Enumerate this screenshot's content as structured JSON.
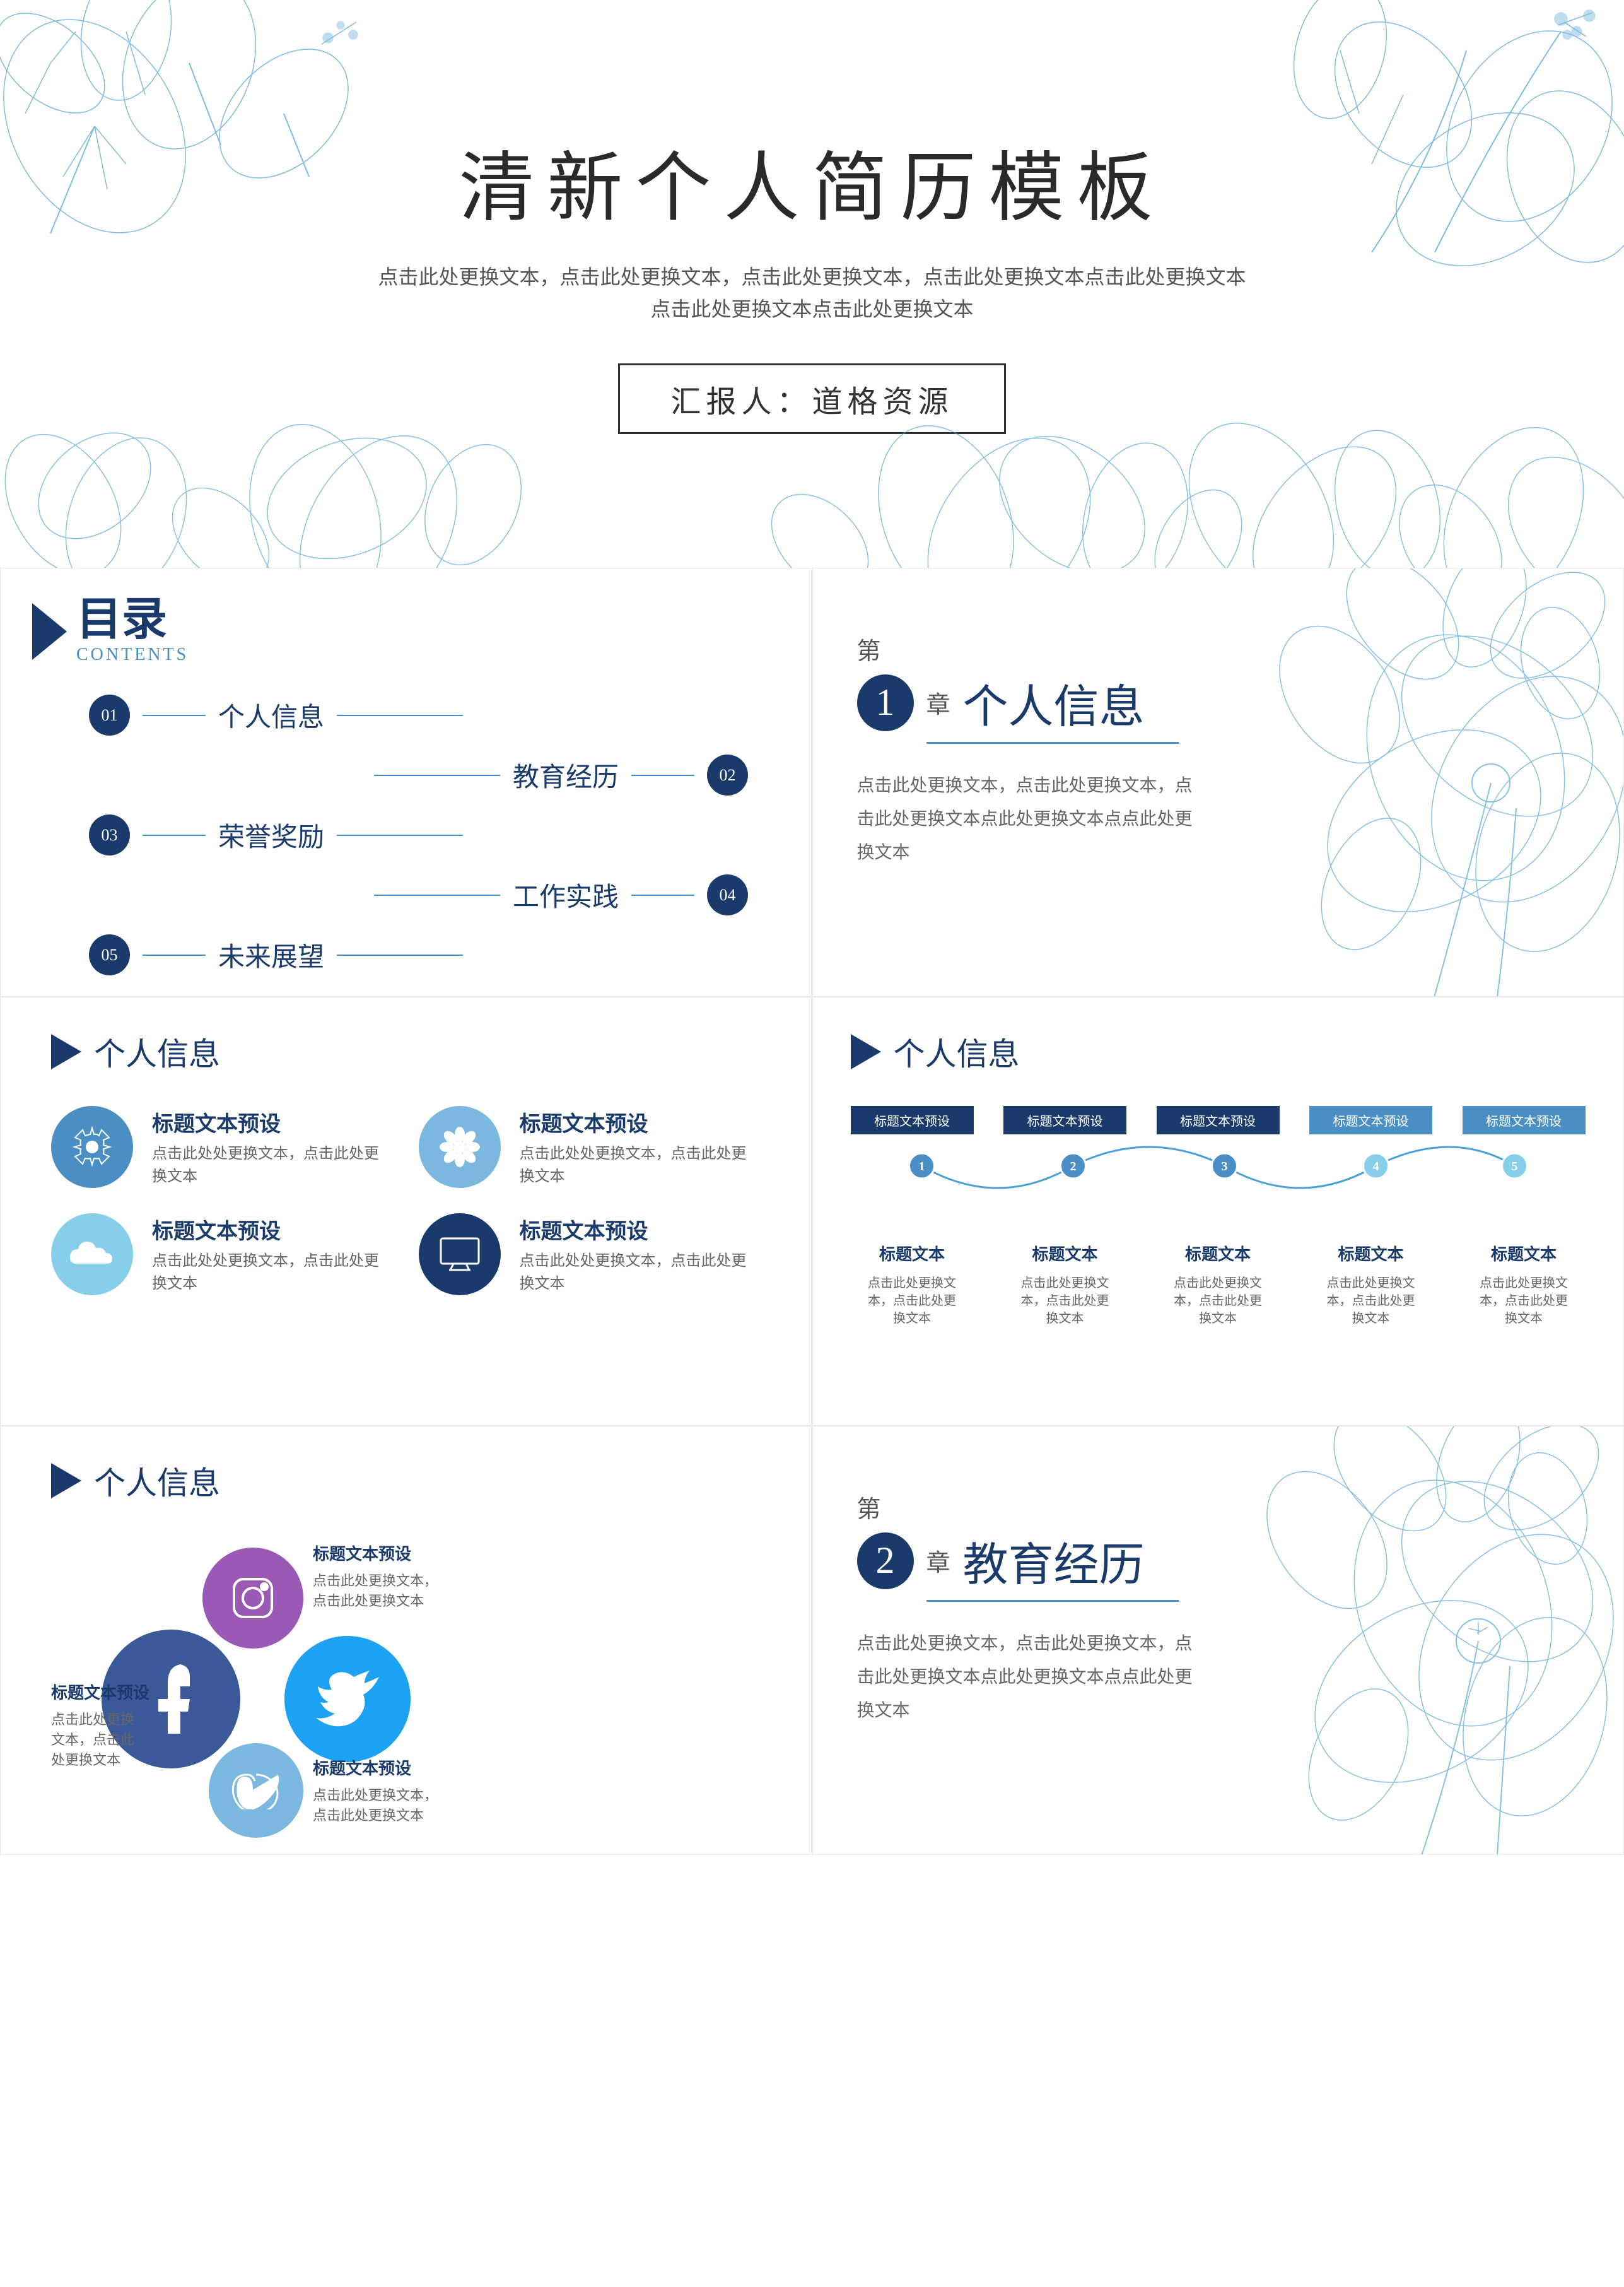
{
  "cover": {
    "title": "清新个人简历模板",
    "subtitle_line1": "点击此处更换文本，点击此处更换文本，点击此处更换文本，点击此处更换文本点击此处更换文本",
    "subtitle_line2": "点击此处更换文本点击此处更换文本",
    "author_label": "汇报人：道格资源"
  },
  "toc": {
    "title_cn": "目录",
    "title_en": "CONTENTS",
    "items": [
      {
        "num": "01",
        "label": "个人信息",
        "align": "left"
      },
      {
        "num": "02",
        "label": "教育经历",
        "align": "right"
      },
      {
        "num": "03",
        "label": "荣誉奖励",
        "align": "left"
      },
      {
        "num": "04",
        "label": "工作实践",
        "align": "right"
      },
      {
        "num": "05",
        "label": "未来展望",
        "align": "left"
      }
    ]
  },
  "chapter1": {
    "chapter_word": "第",
    "chapter_num": "1",
    "chapter_word2": "章",
    "title": "个人信息",
    "desc": "点击此处更换文本，点击此处更换文本，点击此处更换文本点此处更换文本点点此处更换文本"
  },
  "personal_info_icons": {
    "section_title": "个人信息",
    "items": [
      {
        "icon": "⚙",
        "color": "blue",
        "label": "标题文本预设",
        "desc": "点击此处处更换文本，点击此处更换文本"
      },
      {
        "icon": "🌺",
        "color": "light-blue",
        "label": "标题文本预设",
        "desc": "点击此处处更换文本，点击此处更换文本"
      },
      {
        "icon": "☁",
        "color": "sky",
        "label": "标题文本预设",
        "desc": "点击此处处更换文本，点击此处更换文本"
      },
      {
        "icon": "🖥",
        "color": "dark-blue",
        "label": "标题文本预设",
        "desc": "点击此处处更换文本，点击此处更换文本"
      }
    ]
  },
  "personal_info_timeline": {
    "section_title": "个人信息",
    "nodes": [
      {
        "label": "标题文本预设",
        "num": "1",
        "sub": "标题文本",
        "desc": "点击此处更换文本，点击此处更换文本"
      },
      {
        "label": "标题文本预设",
        "num": "2",
        "sub": "标题文本",
        "desc": "点击此处更换文本，点击此处更换文本"
      },
      {
        "label": "标题文本预设",
        "num": "3",
        "sub": "标题文本",
        "desc": "点击此处更换文本，点击此处更换文本"
      },
      {
        "label": "标题文本预设",
        "num": "4",
        "sub": "标题文本",
        "desc": "点击此处更换文本，点击此处更换文本"
      },
      {
        "label": "标题文本预设",
        "num": "5",
        "sub": "标题文本",
        "desc": "点击此处更换文本，点击此处更换文本"
      }
    ]
  },
  "social_info": {
    "section_title": "个人信息",
    "items": [
      {
        "platform": "Instagram",
        "label": "标题文本预设",
        "desc": "点击此处更换文本，点击此处更换文本"
      },
      {
        "platform": "Facebook",
        "label": "标题文本预设",
        "desc": "点击此处更换文本，点击此处更换文本"
      },
      {
        "platform": "Twitter",
        "label": "标题文本预设",
        "desc": "点击此处更换文本，点击此处更换文本"
      },
      {
        "platform": "Vimeo",
        "label": "标题文本预设",
        "desc": "点击此处更换文本，点击此处更换文本"
      }
    ]
  },
  "chapter2": {
    "chapter_word": "第",
    "chapter_num": "2",
    "chapter_word2": "章",
    "title": "教育经历",
    "desc": "点击此处更换文本，点击此处更换文本，点击此处更换文本点此处更换文本点点此处更换文本"
  },
  "colors": {
    "dark_blue": "#1a3a6b",
    "medium_blue": "#4a8fc4",
    "light_blue": "#87ceeb",
    "accent": "#2575c4"
  }
}
